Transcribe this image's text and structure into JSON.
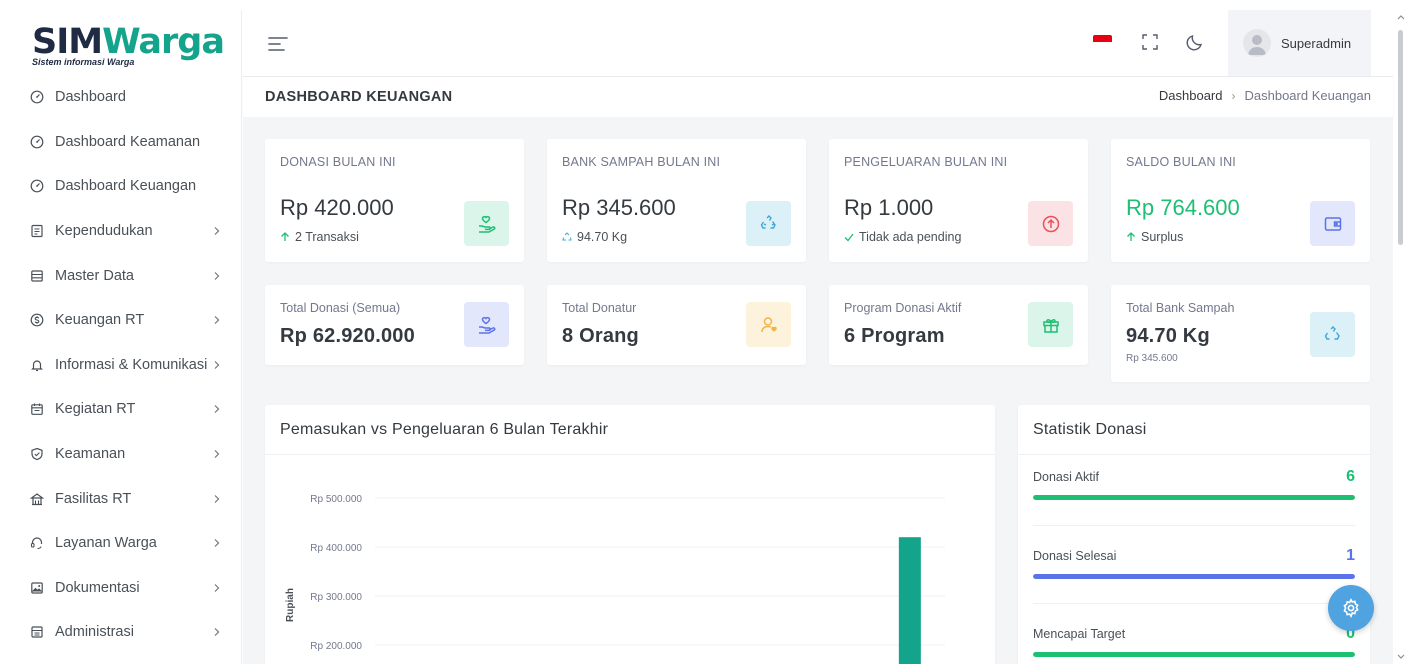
{
  "brand": {
    "name_part1": "SIM",
    "name_part2": "Warga",
    "tagline": "Sistem informasi Warga"
  },
  "sidebar": {
    "items": [
      {
        "label": "Dashboard",
        "icon": "dashboard-icon",
        "has_submenu": false
      },
      {
        "label": "Dashboard Keamanan",
        "icon": "dashboard-icon",
        "has_submenu": false
      },
      {
        "label": "Dashboard Keuangan",
        "icon": "dashboard-icon",
        "has_submenu": false
      },
      {
        "label": "Kependudukan",
        "icon": "id-card-icon",
        "has_submenu": true
      },
      {
        "label": "Master Data",
        "icon": "database-icon",
        "has_submenu": true
      },
      {
        "label": "Keuangan RT",
        "icon": "dollar-circle-icon",
        "has_submenu": true
      },
      {
        "label": "Informasi & Komunikasi",
        "icon": "bell-icon",
        "has_submenu": true
      },
      {
        "label": "Kegiatan RT",
        "icon": "calendar-icon",
        "has_submenu": true
      },
      {
        "label": "Keamanan",
        "icon": "shield-icon",
        "has_submenu": true
      },
      {
        "label": "Fasilitas RT",
        "icon": "building-icon",
        "has_submenu": true
      },
      {
        "label": "Layanan Warga",
        "icon": "support-icon",
        "has_submenu": true
      },
      {
        "label": "Dokumentasi",
        "icon": "image-icon",
        "has_submenu": true
      },
      {
        "label": "Administrasi",
        "icon": "archive-icon",
        "has_submenu": true
      }
    ]
  },
  "topbar": {
    "user_name": "Superadmin",
    "language": "Indonesia"
  },
  "header": {
    "page_title": "DASHBOARD KEUANGAN",
    "breadcrumb": [
      "Dashboard",
      "Dashboard Keuangan"
    ]
  },
  "kpis": [
    {
      "label": "DONASI BULAN INI",
      "value": "Rp 420.000",
      "sub": "2 Transaksi",
      "sub_icon": "arrow-up-icon",
      "icon": "hand-heart-icon",
      "color": "#1dbf73",
      "bg": "#dcf5ea"
    },
    {
      "label": "BANK SAMPAH BULAN INI",
      "value": "Rp 345.600",
      "sub": "94.70 Kg",
      "sub_icon": "recycle-icon",
      "icon": "recycle-icon",
      "color": "#3fa8d5",
      "bg": "#dcf0f8"
    },
    {
      "label": "PENGELUARAN BULAN INI",
      "value": "Rp 1.000",
      "sub": "Tidak ada pending",
      "sub_icon": "check-icon",
      "icon": "arrow-up-circle-icon",
      "color": "#e8505b",
      "bg": "#fbe2e4"
    },
    {
      "label": "SALDO BULAN INI",
      "value": "Rp 764.600",
      "sub": "Surplus",
      "sub_icon": "arrow-up-icon",
      "icon": "wallet-icon",
      "color": "#5b73e8",
      "bg": "#e3e7fb",
      "value_color": "#1dbf73"
    }
  ],
  "stats": [
    {
      "label": "Total Donasi (Semua)",
      "value": "Rp 62.920.000",
      "icon": "hand-heart-icon",
      "color": "#5b73e8",
      "bg": "#e3e7fb"
    },
    {
      "label": "Total Donatur",
      "value": "8 Orang",
      "icon": "user-heart-icon",
      "color": "#f1b44c",
      "bg": "#fdf2dc"
    },
    {
      "label": "Program Donasi Aktif",
      "value": "6 Program",
      "icon": "gift-icon",
      "color": "#1dbf73",
      "bg": "#dcf5ea"
    },
    {
      "label": "Total Bank Sampah",
      "value": "94.70 Kg",
      "sub": "Rp 345.600",
      "icon": "recycle-icon",
      "color": "#3fa8d5",
      "bg": "#dcf0f8"
    }
  ],
  "chart_panel": {
    "title": "Pemasukan vs Pengeluaran 6 Bulan Terakhir"
  },
  "chart_data": {
    "type": "bar",
    "ylabel": "Rupiah",
    "yticks": [
      "Rp 500.000",
      "Rp 400.000",
      "Rp 300.000",
      "Rp 200.000"
    ],
    "ytick_values": [
      500000,
      400000,
      300000,
      200000
    ],
    "visible_ymin": 150000,
    "series": [
      {
        "values": [
          420000
        ],
        "color": "#14a38b"
      }
    ],
    "visible_bar_index": 5,
    "num_categories": 6
  },
  "donation_stats": {
    "title": "Statistik Donasi",
    "items": [
      {
        "label": "Donasi Aktif",
        "value": "6",
        "color": "#1dbf73",
        "fill": 1.0
      },
      {
        "label": "Donasi Selesai",
        "value": "1",
        "color": "#5b73e8",
        "fill": 1.0
      },
      {
        "label": "Mencapai Target",
        "value": "0",
        "color": "#1dbf73",
        "fill": 1.0
      }
    ]
  },
  "colors": {
    "accent": "#14a38b",
    "fab": "#4fa3e0"
  }
}
